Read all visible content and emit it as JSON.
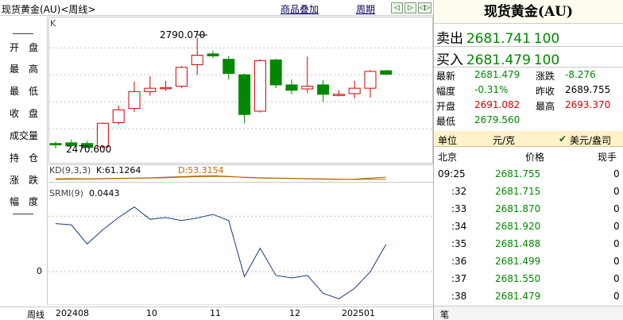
{
  "header": {
    "title": "现货黄金(AU)<周线>",
    "overlay_button": "商品叠加",
    "period_button": "周期",
    "nav": [
      "◁",
      "▷",
      "◁▷"
    ]
  },
  "side_menu": [
    "开　盘",
    "最　高",
    "最　低",
    "收　盘",
    "成交量",
    "持　仓",
    "涨　跌",
    "幅　度"
  ],
  "chart": {
    "panel_label": "K",
    "high_label": "2790.070",
    "low_label": "2470.600",
    "kd_label": "KD(9,3,3)",
    "k_text": "K:61.1264",
    "d_text": "D:53.3154",
    "srmi_label": "SRMI(9)",
    "srmi_value": "0.0443",
    "srmi_axis_zero": "0",
    "x_ticks": [
      "周线",
      "202408",
      "10",
      "11",
      "12",
      "202501"
    ],
    "colors": {
      "up": "#d00000",
      "down": "#008800",
      "line": "#1a3a7a",
      "k": "#8b7000",
      "d": "#c86400"
    }
  },
  "chart_data": [
    {
      "type": "candlestick",
      "title": "现货黄金(AU)<周线>",
      "annotations": {
        "high": 2790.07,
        "low": 2470.6
      },
      "ylim": [
        2440,
        2810
      ],
      "candles": [
        {
          "o": 2476,
          "h": 2482,
          "l": 2462,
          "c": 2472
        },
        {
          "o": 2478,
          "h": 2488,
          "l": 2464,
          "c": 2470
        },
        {
          "o": 2476,
          "h": 2484,
          "l": 2468,
          "c": 2464
        },
        {
          "o": 2466,
          "h": 2538,
          "l": 2462,
          "c": 2536
        },
        {
          "o": 2538,
          "h": 2588,
          "l": 2532,
          "c": 2576
        },
        {
          "o": 2580,
          "h": 2660,
          "l": 2570,
          "c": 2630
        },
        {
          "o": 2630,
          "h": 2676,
          "l": 2618,
          "c": 2640
        },
        {
          "o": 2640,
          "h": 2662,
          "l": 2632,
          "c": 2642
        },
        {
          "o": 2646,
          "h": 2706,
          "l": 2640,
          "c": 2702
        },
        {
          "o": 2710,
          "h": 2790.07,
          "l": 2680,
          "c": 2738
        },
        {
          "o": 2742,
          "h": 2752,
          "l": 2730,
          "c": 2736
        },
        {
          "o": 2726,
          "h": 2736,
          "l": 2666,
          "c": 2684
        },
        {
          "o": 2680,
          "h": 2684,
          "l": 2536,
          "c": 2562
        },
        {
          "o": 2572,
          "h": 2726,
          "l": 2568,
          "c": 2722
        },
        {
          "o": 2724,
          "h": 2728,
          "l": 2640,
          "c": 2650
        },
        {
          "o": 2650,
          "h": 2666,
          "l": 2622,
          "c": 2634
        },
        {
          "o": 2638,
          "h": 2734,
          "l": 2626,
          "c": 2646
        },
        {
          "o": 2650,
          "h": 2664,
          "l": 2600,
          "c": 2622
        },
        {
          "o": 2620,
          "h": 2634,
          "l": 2616,
          "c": 2622
        },
        {
          "o": 2624,
          "h": 2662,
          "l": 2610,
          "c": 2640
        },
        {
          "o": 2640,
          "h": 2694,
          "l": 2612,
          "c": 2690
        },
        {
          "o": 2692,
          "h": 2694,
          "l": 2679.56,
          "c": 2681.479
        }
      ]
    },
    {
      "type": "line",
      "title": "KD(9,3,3)",
      "series": [
        {
          "name": "K:61.1264",
          "values": [
            55,
            56,
            55,
            56,
            57,
            58,
            59,
            61,
            63,
            65,
            66,
            64,
            60,
            58,
            57,
            56,
            55,
            54,
            53,
            54,
            58,
            61.1264
          ]
        },
        {
          "name": "D:53.3154",
          "values": [
            53,
            54,
            54,
            55,
            56,
            57,
            58,
            59,
            61,
            63,
            64,
            63,
            61,
            59,
            58,
            57,
            56,
            55,
            54,
            53,
            54,
            53.3154
          ]
        }
      ]
    },
    {
      "type": "line",
      "title": "SRMI(9)",
      "series": [
        {
          "name": "SRMI(9) 0.0443",
          "values": [
            0.078,
            0.076,
            0.045,
            0.068,
            0.088,
            0.105,
            0.085,
            0.088,
            0.083,
            0.087,
            0.093,
            0.083,
            -0.008,
            0.038,
            -0.006,
            -0.01,
            -0.006,
            -0.035,
            -0.044,
            -0.027,
            0.0,
            0.0443
          ]
        }
      ],
      "ylim": [
        -0.05,
        0.12
      ],
      "ticks": [
        0
      ]
    }
  ],
  "quote": {
    "title": "现货黄金(AU)",
    "sell_label": "卖出",
    "sell_price": "2681.741",
    "sell_qty": "100",
    "buy_label": "买入",
    "buy_price": "2681.479",
    "buy_qty": "100",
    "stats": [
      {
        "l1": "最新",
        "v1": "2681.479",
        "l2": "涨跌",
        "v2": "-8.276"
      },
      {
        "l1": "幅度",
        "v1": "-0.31%",
        "l2": "昨收",
        "v2": "2689.755"
      },
      {
        "l1": "开盘",
        "v1": "2691.082",
        "l2": "最高",
        "v2": "2693.370"
      },
      {
        "l1": "最低",
        "v1": "2679.560",
        "l2": "",
        "v2": ""
      }
    ],
    "unit_label": "单位",
    "unit_value": "元/克",
    "unit_option": "美元/盎司",
    "tick_headers": [
      "北京",
      "价格",
      "现手"
    ],
    "ticks": [
      {
        "time": "09:25",
        "price": "2681.755",
        "vol": "0"
      },
      {
        "time": ":32",
        "price": "2681.715",
        "vol": "0"
      },
      {
        "time": ":33",
        "price": "2681.870",
        "vol": "0"
      },
      {
        "time": ":34",
        "price": "2681.920",
        "vol": "0"
      },
      {
        "time": ":35",
        "price": "2681.488",
        "vol": "0"
      },
      {
        "time": ":36",
        "price": "2681.499",
        "vol": "0"
      },
      {
        "time": ":37",
        "price": "2681.550",
        "vol": "0"
      },
      {
        "time": ":38",
        "price": "2681.479",
        "vol": "0"
      }
    ],
    "footer_tab": "笔"
  }
}
